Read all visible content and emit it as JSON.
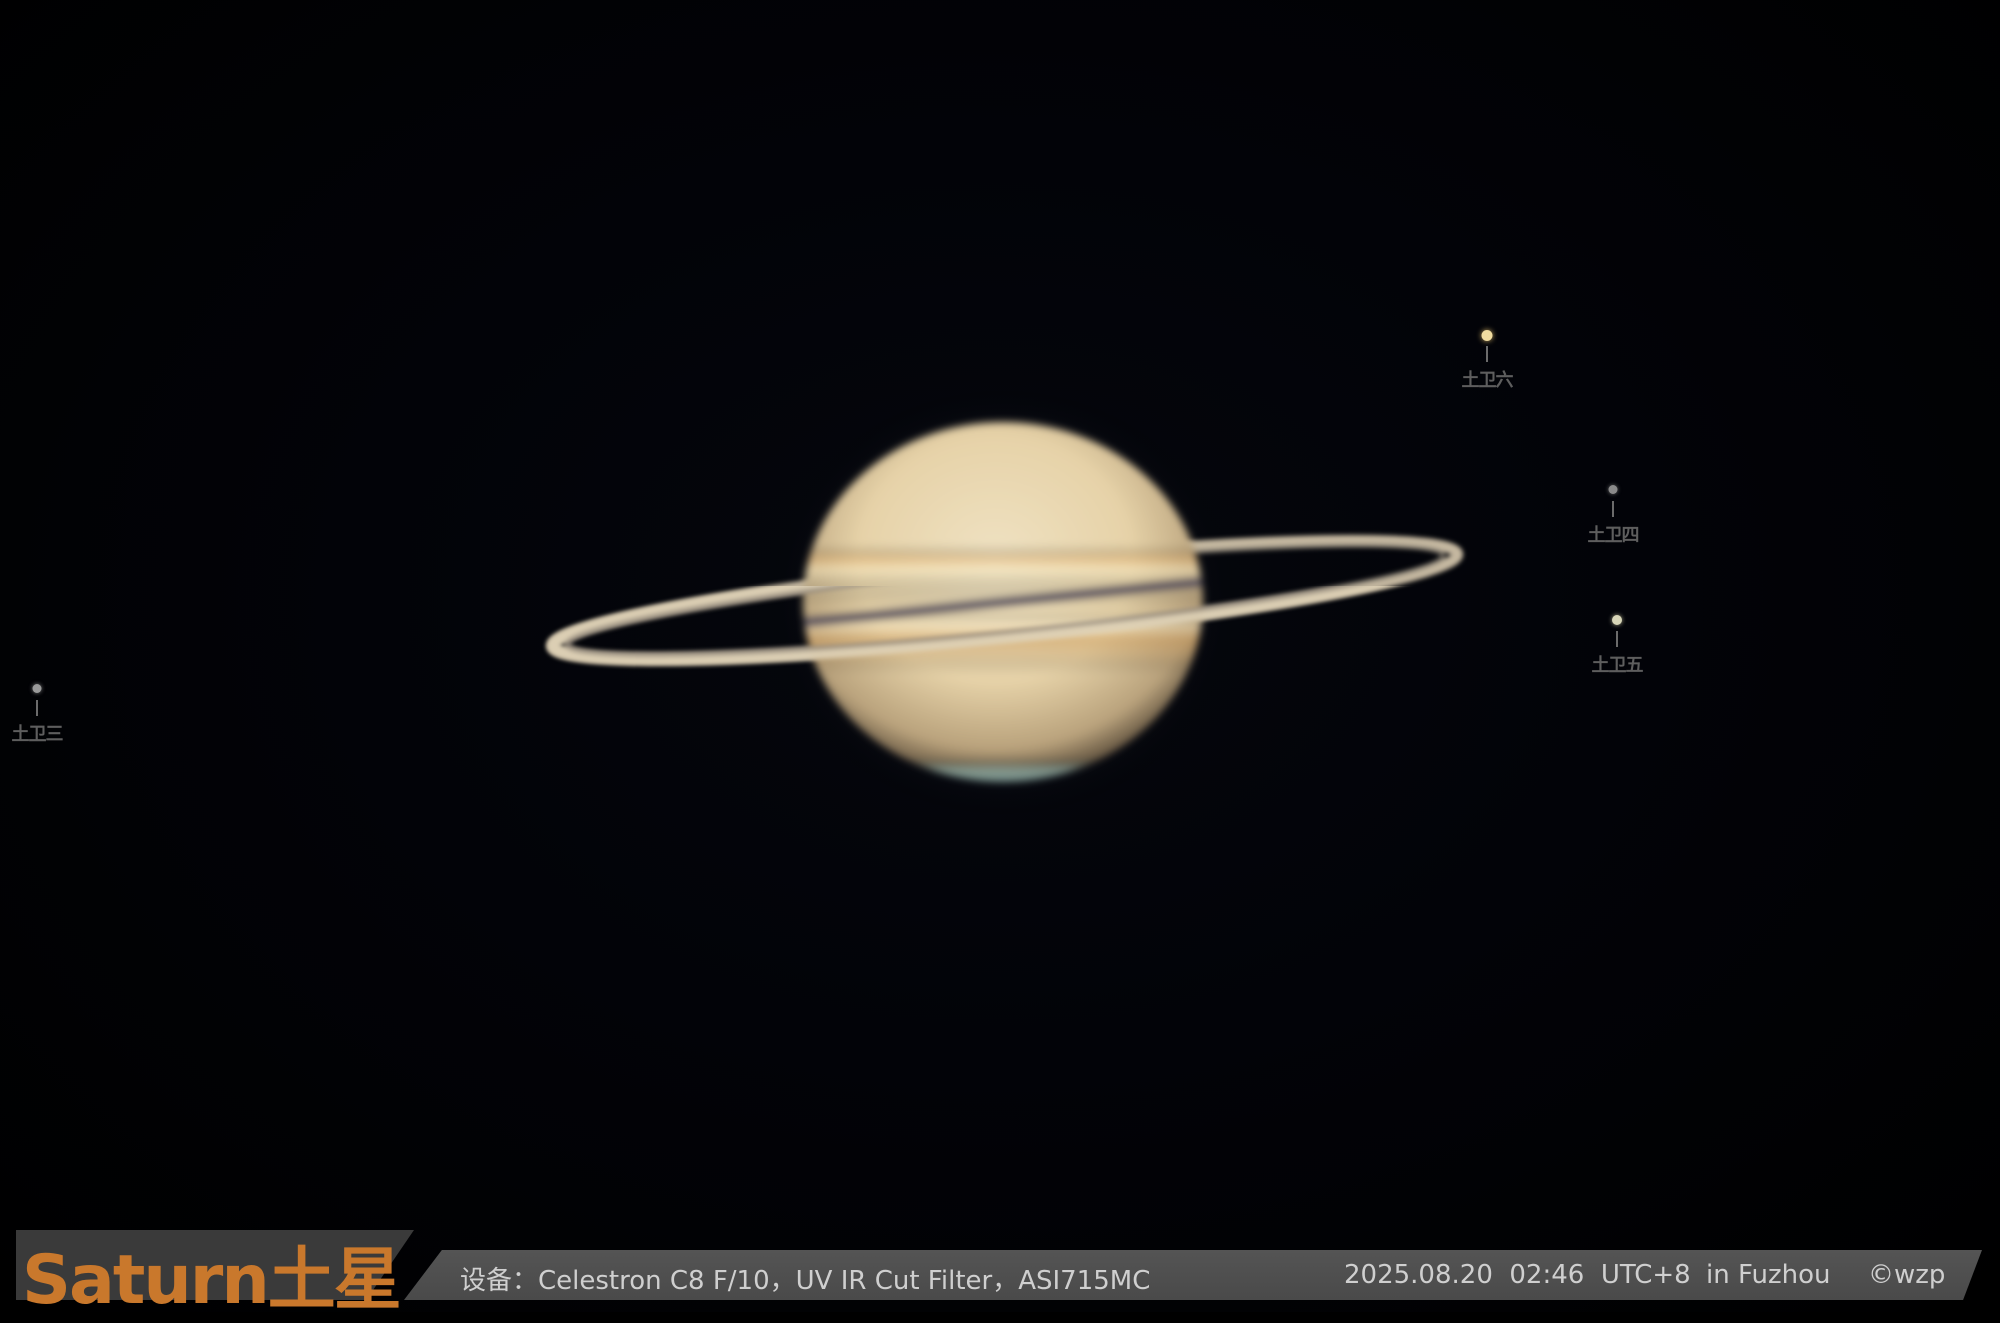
{
  "image": {
    "subject": "Saturn",
    "colors": {
      "background": "#000000",
      "planet": "#e8d6b0",
      "bar": "#4d4d4d",
      "title": "#c9782c"
    }
  },
  "moons": [
    {
      "label": "土卫六",
      "color": "#f0dca0"
    },
    {
      "label": "土卫四",
      "color": "#8a8a8a"
    },
    {
      "label": "土卫五",
      "color": "#d8d6b8"
    },
    {
      "label": "土卫三",
      "color": "#9a9a9a"
    }
  ],
  "caption": {
    "title": "Saturn土星",
    "equipment": "设备：Celestron C8 F/10，UV IR Cut Filter，ASI715MC",
    "datetime": "2025.08.20  02:46  UTC+8",
    "location": "in Fuzhou",
    "credit": "©wzp"
  }
}
